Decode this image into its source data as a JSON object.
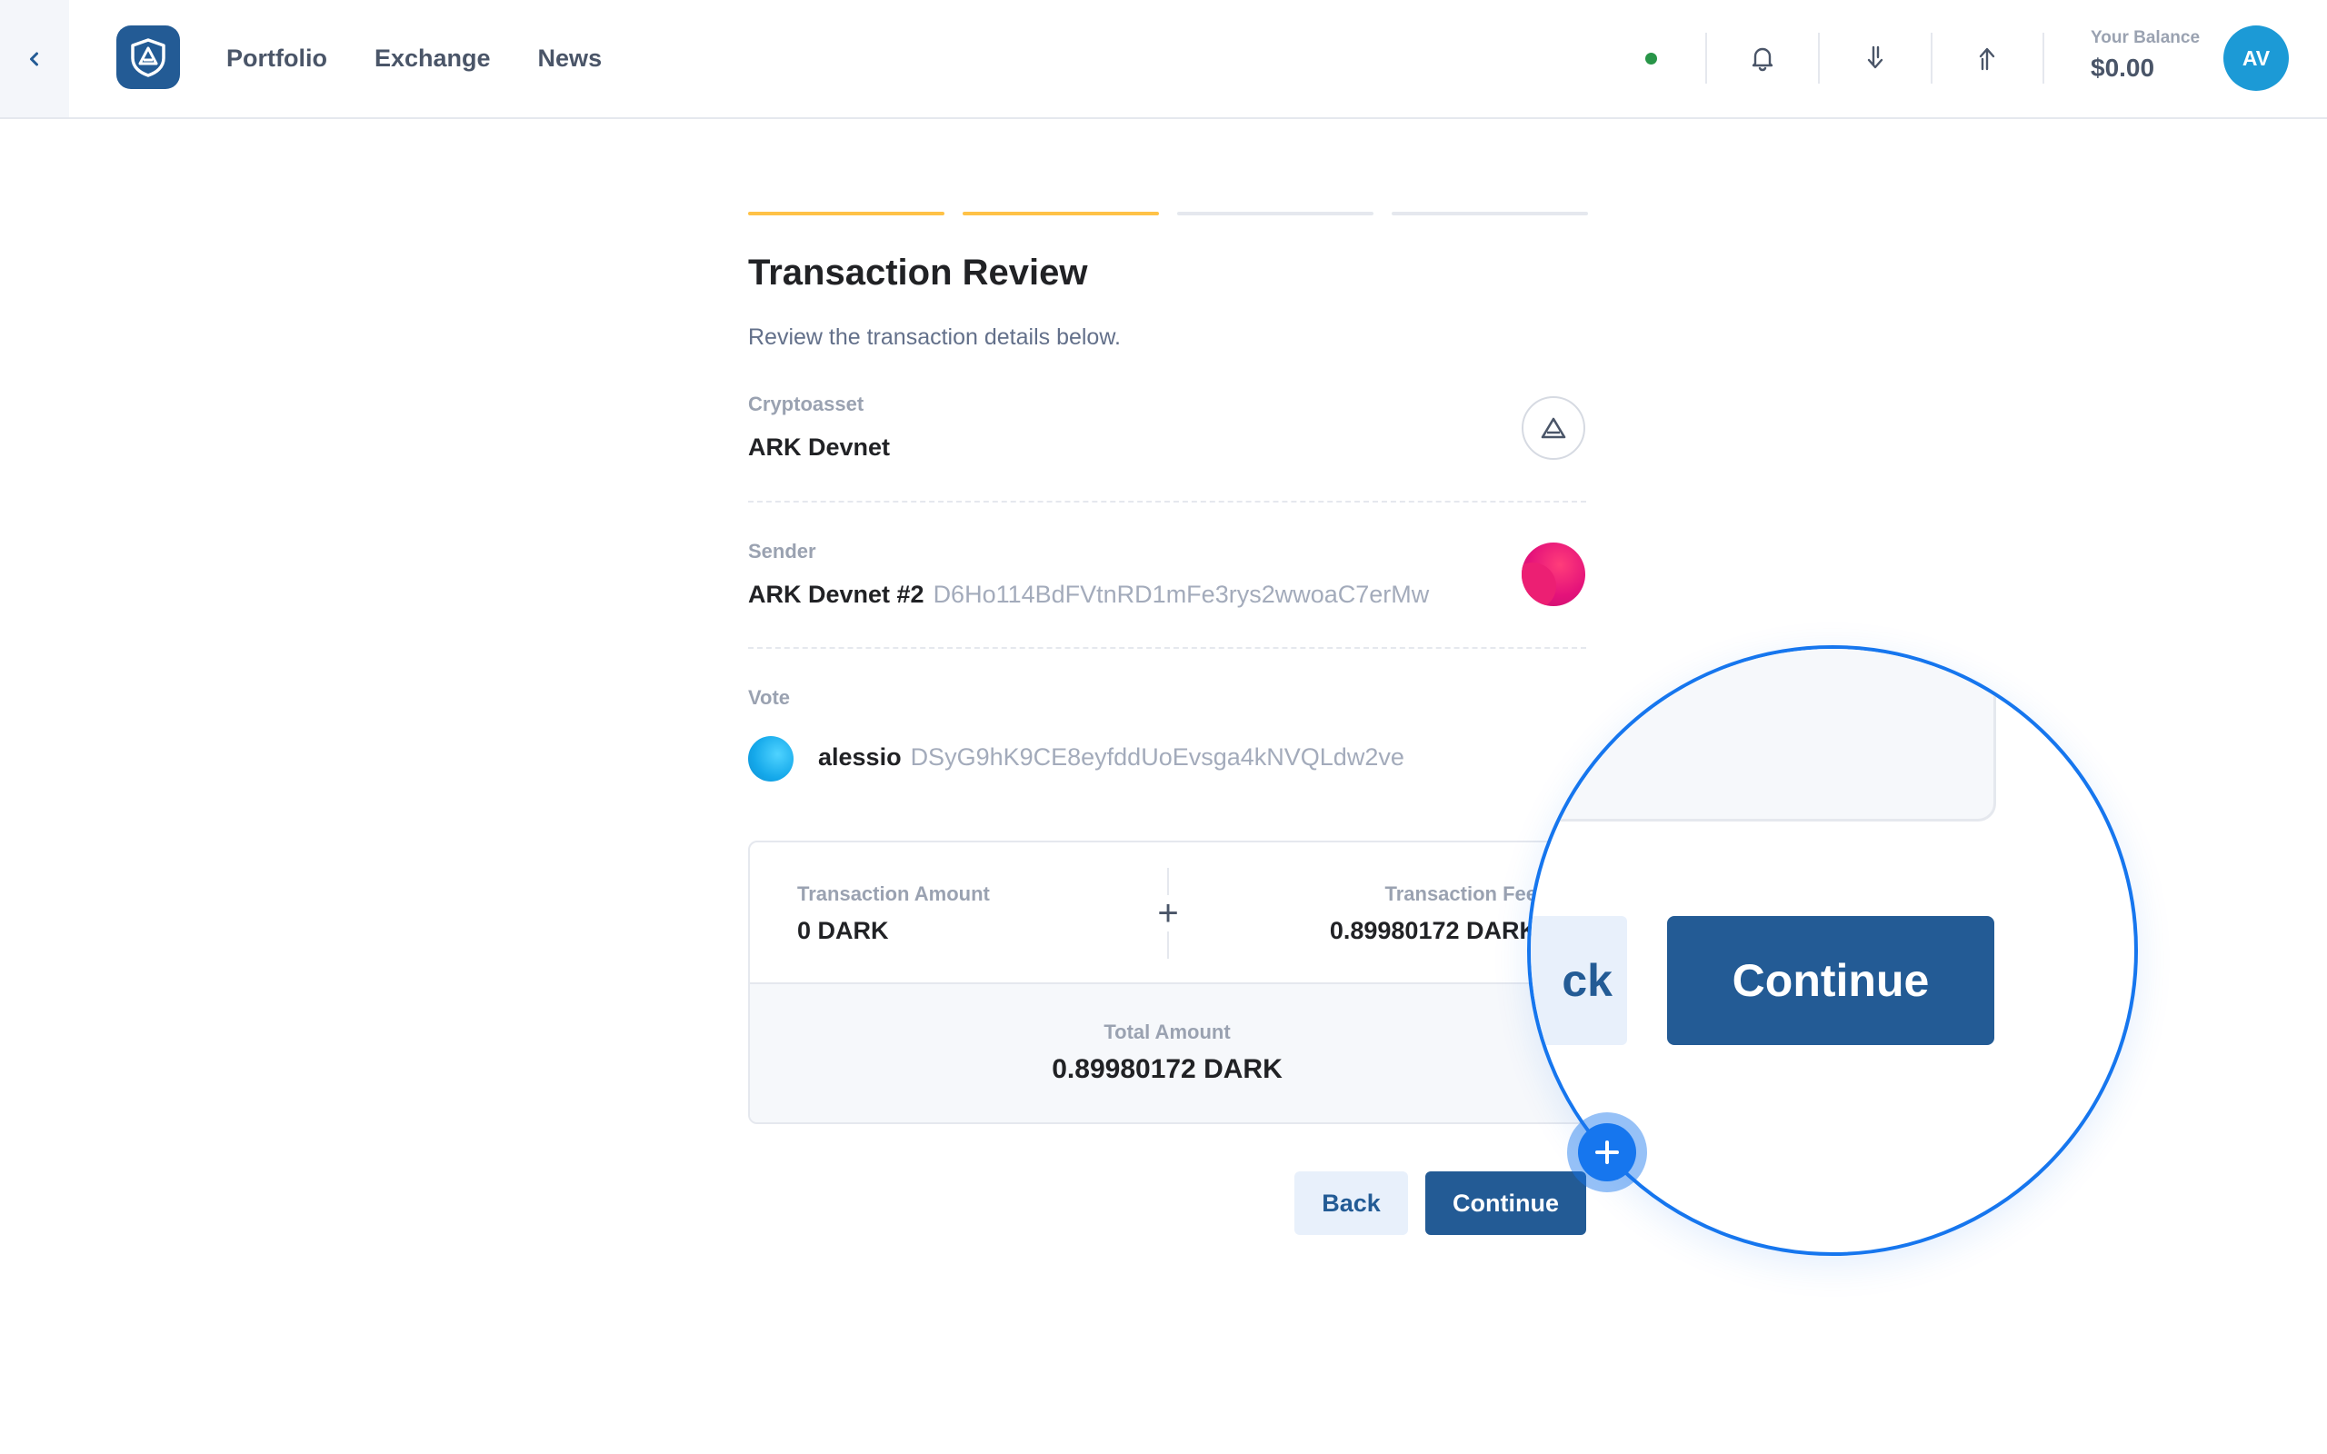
{
  "header": {
    "nav": [
      "Portfolio",
      "Exchange",
      "News"
    ],
    "balance_label": "Your Balance",
    "balance_value": "$0.00",
    "avatar_initials": "AV",
    "icons": [
      "chevron-left-icon",
      "ark-logo-icon",
      "bell-icon",
      "arrow-down-icon",
      "arrow-up-icon"
    ],
    "status_color": "#289548"
  },
  "steps": {
    "total": 4,
    "completed": 2,
    "active_color": "#ffc247"
  },
  "page": {
    "title": "Transaction Review",
    "subtitle": "Review the transaction details below."
  },
  "cryptoasset": {
    "label": "Cryptoasset",
    "value": "ARK Devnet"
  },
  "sender": {
    "label": "Sender",
    "name": "ARK Devnet #2",
    "address": "D6Ho114BdFVtnRD1mFe3rys2wwoaC7erMw"
  },
  "vote": {
    "label": "Vote",
    "name": "alessio",
    "address": "DSyG9hK9CE8eyfddUoEvsga4kNVQLdw2ve"
  },
  "summary": {
    "amount_label": "Transaction Amount",
    "amount_value": "0 DARK",
    "plus": "+",
    "fee_label": "Transaction Fee",
    "fee_value": "0.89980172 DARK",
    "total_label": "Total Amount",
    "total_value": "0.89980172 DARK"
  },
  "buttons": {
    "back": "Back",
    "continue": "Continue"
  },
  "magnifier": {
    "back_fragment": "ck",
    "continue": "Continue"
  },
  "colors": {
    "brand": "#235b95",
    "accent": "#1676ee"
  }
}
